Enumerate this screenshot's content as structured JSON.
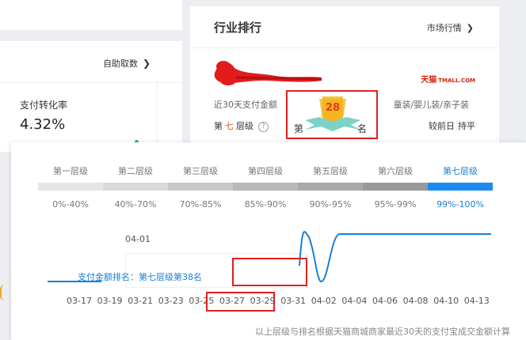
{
  "left_panel": {
    "self_fetch_label": "自助取数",
    "conversion_label": "支付转化率",
    "conversion_value": "4.32%"
  },
  "ranking_card": {
    "title": "行业排行",
    "market_link": "市场行情",
    "store_brand": "天猫",
    "store_brand_en": "TMALL.COM",
    "pay_amount_label": "近30天支付金额",
    "category": "童装/婴儿装/亲子装",
    "level_prefix": "第",
    "level_num": "七",
    "level_suffix": "层级",
    "rank_prefix": "第",
    "rank_number": "28",
    "rank_suffix": "名",
    "compare_label": "较前日",
    "compare_value": "持平"
  },
  "levels": [
    {
      "name": "第一层级",
      "range": "0%-40%",
      "color": "#e5e5e5"
    },
    {
      "name": "第二层级",
      "range": "40%-70%",
      "color": "#d9d9d9"
    },
    {
      "name": "第三层级",
      "range": "70%-85%",
      "color": "#c8c8c8"
    },
    {
      "name": "第四层级",
      "range": "85%-90%",
      "color": "#b9b9b9"
    },
    {
      "name": "第五层级",
      "range": "90%-95%",
      "color": "#a9a9a9"
    },
    {
      "name": "第六层级",
      "range": "95%-99%",
      "color": "#999999"
    },
    {
      "name": "第七层级",
      "range": "99%-100%",
      "color": "#1a8cf0"
    }
  ],
  "chart": {
    "y_tick_label": "04-01",
    "tooltip_text": "支付金额排名：第七层级第38名",
    "x_ticks": [
      "03-17",
      "03-19",
      "03-21",
      "03-23",
      "03-25",
      "03-27",
      "03-29",
      "03-31",
      "04-02",
      "04-04",
      "04-06",
      "04-08",
      "04-10",
      "04-13"
    ],
    "footnote": "以上层级与排名根据天猫商城商家最近30天的支付宝成交金额计算",
    "line_color": "#1a7fd4"
  }
}
